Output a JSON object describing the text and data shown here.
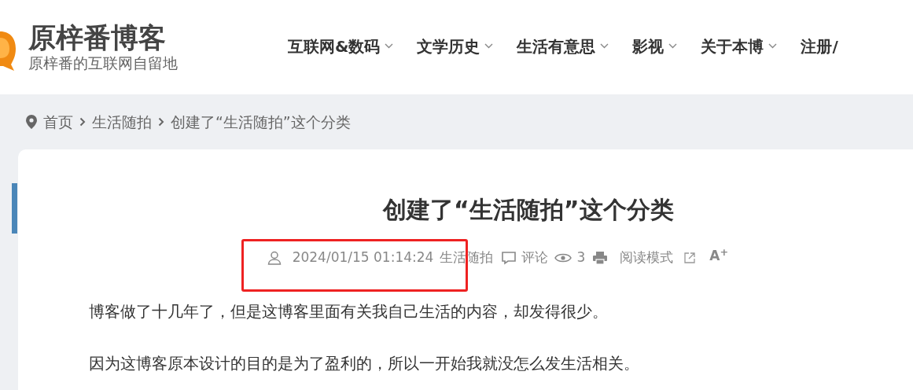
{
  "site": {
    "title": "原梓番博客",
    "subtitle": "原梓番的互联网自留地"
  },
  "nav": [
    {
      "label": "互联网&数码",
      "dropdown": true
    },
    {
      "label": "文学历史",
      "dropdown": true
    },
    {
      "label": "生活有意思",
      "dropdown": true
    },
    {
      "label": "影视",
      "dropdown": true
    },
    {
      "label": "关于本博",
      "dropdown": true
    },
    {
      "label": "注册/",
      "dropdown": false
    }
  ],
  "breadcrumb": [
    "首页",
    "生活随拍",
    "创建了“生活随拍”这个分类"
  ],
  "article": {
    "title": "创建了“生活随拍”这个分类",
    "meta": {
      "datetime": "2024/01/15 01:14:24",
      "category": "生活随拍",
      "comments": "评论",
      "views": "3",
      "reading_mode": "阅读模式",
      "font_size": "A$^{+}$"
    },
    "paragraphs": [
      "博客做了十几年了，但是这博客里面有关我自己生活的内容，却发得很少。",
      "因为这博客原本设计的目的是为了盈利的，所以一开始我就没怎么发生活相关。"
    ]
  }
}
